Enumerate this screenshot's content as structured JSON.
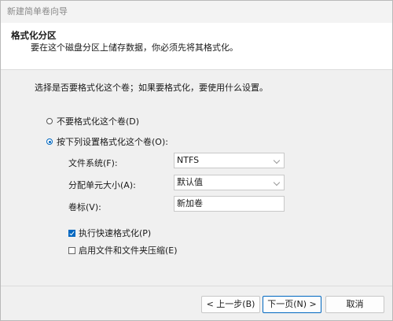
{
  "window": {
    "title": "新建简单卷向导"
  },
  "header": {
    "title": "格式化分区",
    "subtitle": "要在这个磁盘分区上储存数据，你必须先将其格式化。"
  },
  "content": {
    "question": "选择是否要格式化这个卷；如果要格式化，要使用什么设置。",
    "radio_no_format": "不要格式化这个卷(D)",
    "radio_format": "按下列设置格式化这个卷(O):",
    "filesystem_label": "文件系统(F):",
    "filesystem_value": "NTFS",
    "alloc_label": "分配单元大小(A):",
    "alloc_value": "默认值",
    "volume_label_label": "卷标(V):",
    "volume_label_value": "新加卷",
    "quick_format_label": "执行快速格式化(P)",
    "compression_label": "启用文件和文件夹压缩(E)"
  },
  "footer": {
    "back_label": "< 上一步(B)",
    "next_label": "下一页(N) >",
    "cancel_label": "取消"
  },
  "colors": {
    "accent": "#0067c0"
  }
}
